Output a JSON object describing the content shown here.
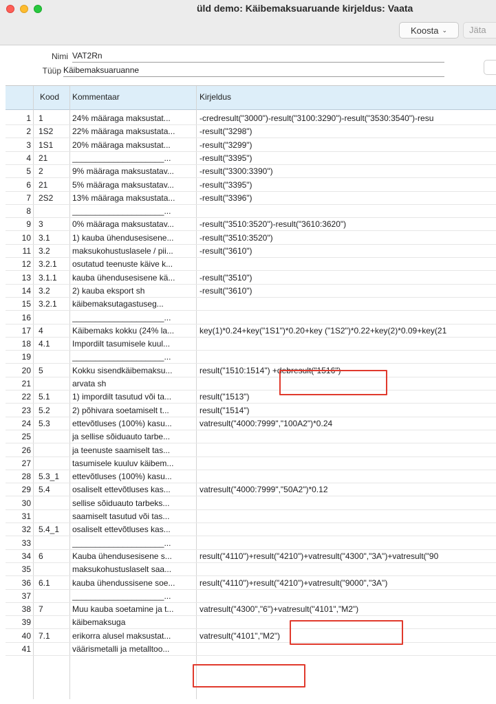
{
  "window": {
    "title": "üld demo: Käibemaksuaruande kirjeldus: Vaata"
  },
  "toolbar": {
    "koosta_label": "Koosta",
    "jata_label": "Jäta"
  },
  "form": {
    "nimi_label": "Nimi",
    "nimi_value": "VAT2Rn",
    "tuup_label": "Tüüp",
    "tuup_value": "Käibemaksuaruanne"
  },
  "table": {
    "headers": {
      "kood": "Kood",
      "kommentaar": "Kommentaar",
      "kirjeldus": "Kirjeldus"
    },
    "rows": [
      {
        "n": "1",
        "kood": "1",
        "kom": "24% määraga maksustat...",
        "kir": "-credresult(\"3000\")-result(\"3100:3290\")-result(\"3530:3540\")-resu"
      },
      {
        "n": "2",
        "kood": "1S2",
        "kom": "22% määraga maksustata...",
        "kir": "-result(\"3298\")"
      },
      {
        "n": "3",
        "kood": "1S1",
        "kom": "20% määraga maksustat...",
        "kir": "-result(\"3299\")"
      },
      {
        "n": "4",
        "kood": "21",
        "kom": "____________________...",
        "kir": "-result(\"3395\")"
      },
      {
        "n": "5",
        "kood": "2",
        "kom": "9% määraga maksustatav...",
        "kir": "-result(\"3300:3390\")"
      },
      {
        "n": "6",
        "kood": "21",
        "kom": "5% määraga maksustatav...",
        "kir": "-result(\"3395\")"
      },
      {
        "n": "7",
        "kood": "2S2",
        "kom": "13% määraga maksustata...",
        "kir": "-result(\"3396\")"
      },
      {
        "n": "8",
        "kood": "",
        "kom": "____________________...",
        "kir": ""
      },
      {
        "n": "9",
        "kood": "3",
        "kom": "0% määraga maksustatav...",
        "kir": "-result(\"3510:3520\")-result(\"3610:3620\")"
      },
      {
        "n": "10",
        "kood": "3.1",
        "kom": "1) kauba ühendusesisene...",
        "kir": "-result(\"3510:3520\")"
      },
      {
        "n": "11",
        "kood": "3.2",
        "kom": "maksukohustuslasele / pii...",
        "kir": "-result(\"3610\")"
      },
      {
        "n": "12",
        "kood": "3.2.1",
        "kom": "osutatud teenuste käive k...",
        "kir": ""
      },
      {
        "n": "13",
        "kood": "3.1.1",
        "kom": "kauba ühendusesisene kä...",
        "kir": "-result(\"3510\")"
      },
      {
        "n": "14",
        "kood": "3.2",
        "kom": "2) kauba eksport sh",
        "kir": "-result(\"3610\")"
      },
      {
        "n": "15",
        "kood": "3.2.1",
        "kom": "   käibemaksutagastuseg...",
        "kir": ""
      },
      {
        "n": "16",
        "kood": "",
        "kom": "____________________...",
        "kir": ""
      },
      {
        "n": "17",
        "kood": "4",
        "kom": "Käibemaks kokku (24% la...",
        "kir": "key(1)*0.24+key(\"1S1\")*0.20+key (\"1S2\")*0.22+key(2)*0.09+key(21"
      },
      {
        "n": "18",
        "kood": "4.1",
        "kom": "Impordilt tasumisele kuul...",
        "kir": ""
      },
      {
        "n": "19",
        "kood": "",
        "kom": "____________________...",
        "kir": ""
      },
      {
        "n": "20",
        "kood": "5",
        "kom": "Kokku sisendkäibemaksu...",
        "kir": "result(\"1510:1514\") +debresult(\"1516\")"
      },
      {
        "n": "21",
        "kood": "",
        "kom": "arvata sh",
        "kir": ""
      },
      {
        "n": "22",
        "kood": "5.1",
        "kom": "1) impordilt tasutud või ta...",
        "kir": "result(\"1513\")"
      },
      {
        "n": "23",
        "kood": "5.2",
        "kom": "2) põhivara soetamiselt t...",
        "kir": "result(\"1514\")"
      },
      {
        "n": "24",
        "kood": "5.3",
        "kom": "ettevõtluses (100%) kasu...",
        "kir": "vatresult(\"4000:7999\",\"100A2\")*0.24"
      },
      {
        "n": "25",
        "kood": "",
        "kom": "ja sellise sõiduauto tarbe...",
        "kir": ""
      },
      {
        "n": "26",
        "kood": "",
        "kom": "ja teenuste saamiselt tas...",
        "kir": ""
      },
      {
        "n": "27",
        "kood": "",
        "kom": "tasumisele kuuluv käibem...",
        "kir": ""
      },
      {
        "n": "28",
        "kood": "5.3_1",
        "kom": "ettevõtluses (100%) kasu...",
        "kir": ""
      },
      {
        "n": "29",
        "kood": "5.4",
        "kom": "osaliselt ettevõtluses kas...",
        "kir": "vatresult(\"4000:7999\",\"50A2\")*0.12"
      },
      {
        "n": "30",
        "kood": "",
        "kom": "sellise sõiduauto tarbeks...",
        "kir": ""
      },
      {
        "n": "31",
        "kood": "",
        "kom": "saamiselt  tasutud või tas...",
        "kir": ""
      },
      {
        "n": "32",
        "kood": "5.4_1",
        "kom": "osaliselt ettevõtluses kas...",
        "kir": ""
      },
      {
        "n": "33",
        "kood": "",
        "kom": "____________________...",
        "kir": ""
      },
      {
        "n": "34",
        "kood": "6",
        "kom": "Kauba ühendusesisene s...",
        "kir": "result(\"4110\")+result(\"4210\")+vatresult(\"4300\",\"3A\")+vatresult(\"90"
      },
      {
        "n": "35",
        "kood": "",
        "kom": "maksukohustuslaselt saa...",
        "kir": ""
      },
      {
        "n": "36",
        "kood": "6.1",
        "kom": "kauba ühendussisene soe...",
        "kir": "result(\"4110\")+result(\"4210\")+vatresult(\"9000\",\"3A\")"
      },
      {
        "n": "37",
        "kood": "",
        "kom": "____________________...",
        "kir": ""
      },
      {
        "n": "38",
        "kood": "7",
        "kom": "Muu kauba soetamine ja t...",
        "kir": "vatresult(\"4300\",\"6\")+vatresult(\"4101\",\"M2\")"
      },
      {
        "n": "39",
        "kood": "",
        "kom": "käibemaksuga",
        "kir": ""
      },
      {
        "n": "40",
        "kood": "7.1",
        "kom": " erikorra alusel maksustat...",
        "kir": "vatresult(\"4101\",\"M2\")"
      },
      {
        "n": "41",
        "kood": "",
        "kom": "väärismetalli ja metalltoo...",
        "kir": ""
      }
    ]
  }
}
